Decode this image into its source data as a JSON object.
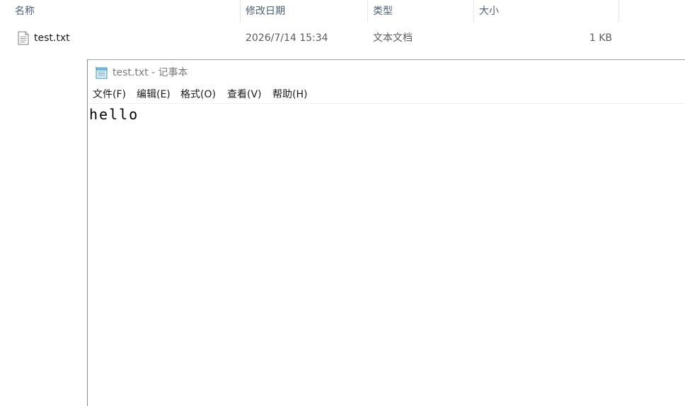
{
  "explorer": {
    "columns": {
      "name": "名称",
      "modified": "修改日期",
      "type": "类型",
      "size": "大小"
    },
    "sort_indicator": "^",
    "files": [
      {
        "name": "test.txt",
        "modified": "2026/7/14 15:34",
        "type": "文本文档",
        "size": "1 KB",
        "icon": "text-document-icon"
      }
    ]
  },
  "notepad": {
    "title": "test.txt - 记事本",
    "icon": "notepad-icon",
    "menu": [
      {
        "label": "文件(F)"
      },
      {
        "label": "编辑(E)"
      },
      {
        "label": "格式(O)"
      },
      {
        "label": "查看(V)"
      },
      {
        "label": "帮助(H)"
      }
    ],
    "content": "hello"
  },
  "colors": {
    "header_text": "#4c607a",
    "title_text": "#7a7a7a"
  }
}
